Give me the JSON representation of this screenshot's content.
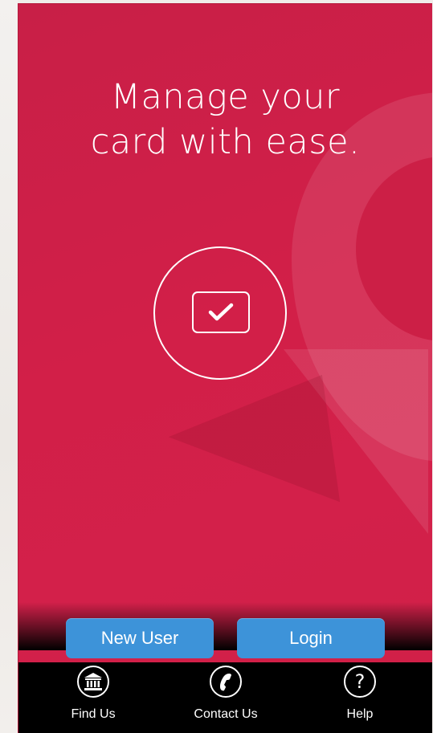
{
  "hero": {
    "headline_line1": "Manage your",
    "headline_line2": "card with ease."
  },
  "actions": {
    "new_user_label": "New User",
    "login_label": "Login"
  },
  "tabbar": {
    "items": [
      {
        "label": "Find Us",
        "icon": "bank-icon"
      },
      {
        "label": "Contact Us",
        "icon": "phone-icon"
      },
      {
        "label": "Help",
        "icon": "question-icon"
      }
    ]
  },
  "colors": {
    "background": "#d0204a",
    "button": "#3d93d9",
    "tabbar": "#000000",
    "text": "#ffffff"
  }
}
